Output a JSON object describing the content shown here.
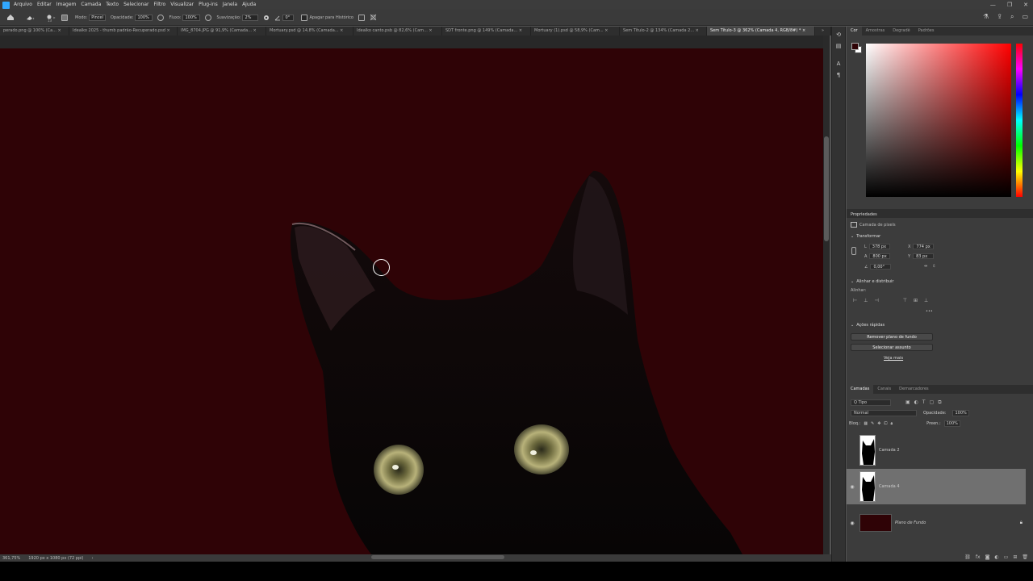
{
  "menu": [
    "Arquivo",
    "Editar",
    "Imagem",
    "Camada",
    "Texto",
    "Selecionar",
    "Filtro",
    "Visualizar",
    "Plug-ins",
    "Janela",
    "Ajuda"
  ],
  "window_controls": [
    "—",
    "❐",
    "✕"
  ],
  "options": {
    "mode_label": "Modo:",
    "mode_value": "Pincel",
    "opacity_label": "Opacidade:",
    "opacity_value": "100%",
    "flow_label": "Fluxo:",
    "flow_value": "100%",
    "smoothing_label": "Suavização:",
    "smoothing_value": "2%",
    "angle_value": "0°",
    "erase_history_label": "Apagar para Histórico"
  },
  "doc_tabs": [
    "perado.png @ 100% (Ca... ×",
    "Idealko 2025 - thumb padrão-Recuperado.psd ×",
    "IMG_8704.JPG @ 91,9% (Camada... ×",
    "Mortuary.psd @ 14,8% (Camada... ×",
    "Idealko canto.psb @ 82,6% (Cam... ×",
    "SDT fronte.png @ 149% (Camada... ×",
    "Mortuary (1).psd @ 58,9% (Cam... ×",
    "Sem Título-2 @ 134% (Camada 2... ×",
    "Sem Título-3 @ 362% (Camada 4, RGB/8#) * ×"
  ],
  "status": {
    "zoom": "361,75%",
    "doc_size": "1920 px x 1080 px (72 ppi)"
  },
  "color_panel_tabs": [
    "Cor",
    "Amostras",
    "Degradê",
    "Padrões"
  ],
  "properties": {
    "title": "Propriedades",
    "layer_type": "Camada de pixels",
    "transform_title": "Transformar",
    "w_label": "L",
    "w_value": "378 px",
    "x_label": "X",
    "x_value": "774 px",
    "h_label": "A",
    "h_value": "800 px",
    "y_label": "Y",
    "y_value": "83 px",
    "angle_value": "0,00°",
    "align_title": "Alinhar e distribuir",
    "align_label": "Alinhar:",
    "more": "•••",
    "quick_title": "Ações rápidas",
    "remove_bg": "Remover plano de fundo",
    "select_subject": "Selecionar assunto",
    "see_more": "Veja mais"
  },
  "layers_panel": {
    "tabs": [
      "Camadas",
      "Canais",
      "Demarcadores"
    ],
    "kind": "Q Tipo",
    "blend": "Normal",
    "opacity_label": "Opacidade:",
    "opacity_value": "100%",
    "lock_label": "Bloq.:",
    "fill_label": "Preen.:",
    "fill_value": "100%",
    "layers": [
      {
        "name": "Camada 2",
        "visible": false
      },
      {
        "name": "Camada 4",
        "visible": true
      },
      {
        "name": "Plano de Fundo",
        "visible": true
      }
    ]
  },
  "colors": {
    "canvas_bg": "#2f0306",
    "panel_bg": "#3c3c3c",
    "selected_layer": "#707070"
  }
}
